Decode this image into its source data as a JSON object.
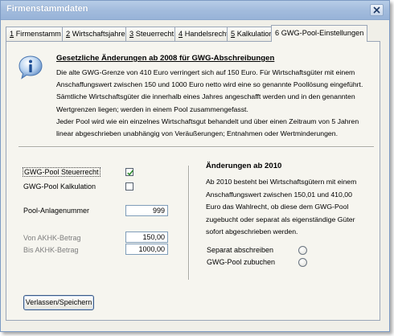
{
  "window": {
    "title": "Firmenstammdaten"
  },
  "tabs": [
    {
      "key": "1",
      "label": "Firmenstamm"
    },
    {
      "key": "2",
      "label": "Wirtschaftsjahre"
    },
    {
      "key": "3",
      "label": "Steuerrecht"
    },
    {
      "key": "4",
      "label": "Handelsrecht"
    },
    {
      "key": "5",
      "label": "Kalkulation"
    },
    {
      "key": "6",
      "label": "GWG-Pool-Einstellungen"
    }
  ],
  "active_tab": "6",
  "info": {
    "icon": "info-icon",
    "title": "Gesetzliche Änderungen ab 2008 für GWG-Abschreibungen",
    "lines": [
      "Die alte GWG-Grenze von 410 Euro verringert sich auf 150 Euro. Für Wirtschaftsgüter mit einem",
      "Anschaffungswert zwischen 150 und 1000 Euro netto wird eine so genannte Poollösung eingeführt.",
      "Sämtliche Wirtschaftsgüter die innerhalb eines Jahres angeschafft werden und in den genannten",
      "Wertgrenzen liegen; werden in einem Pool zusammengefasst.",
      "Jeder Pool wird wie ein einzelnes Wirtschaftsgut behandelt und über einen Zeitraum von 5 Jahren",
      "linear abgeschrieben unabhängig von Veräußerungen; Entnahmen oder Wertminderungen."
    ]
  },
  "settings": {
    "pool_steuerrecht_label": "GWG-Pool Steuerrecht",
    "pool_steuerrecht_checked": true,
    "pool_kalkulation_label": "GWG-Pool Kalkulation",
    "pool_kalkulation_checked": false,
    "anlagenummer_label": "Pool-Anlagenummer",
    "anlagenummer_value": "999",
    "von_label": "Von AKHK-Betrag",
    "von_value": "150,00",
    "bis_label": "Bis AKHK-Betrag",
    "bis_value": "1000,00"
  },
  "changes2010": {
    "title": "Änderungen ab 2010",
    "lines": [
      "Ab 2010 besteht bei Wirtschaftsgütern mit einem",
      "Anschaffungswert zwischen 150,01 und 410,00",
      "Euro das Wahlrecht, ob diese dem GWG-Pool",
      "zugebucht oder separat als eigenständige Güter",
      "sofort abgeschrieben werden."
    ],
    "option_separat_label": "Separat abschreiben",
    "option_pool_label": "GWG-Pool zubuchen"
  },
  "footer": {
    "save_button_label": "Verlassen/Speichern"
  }
}
